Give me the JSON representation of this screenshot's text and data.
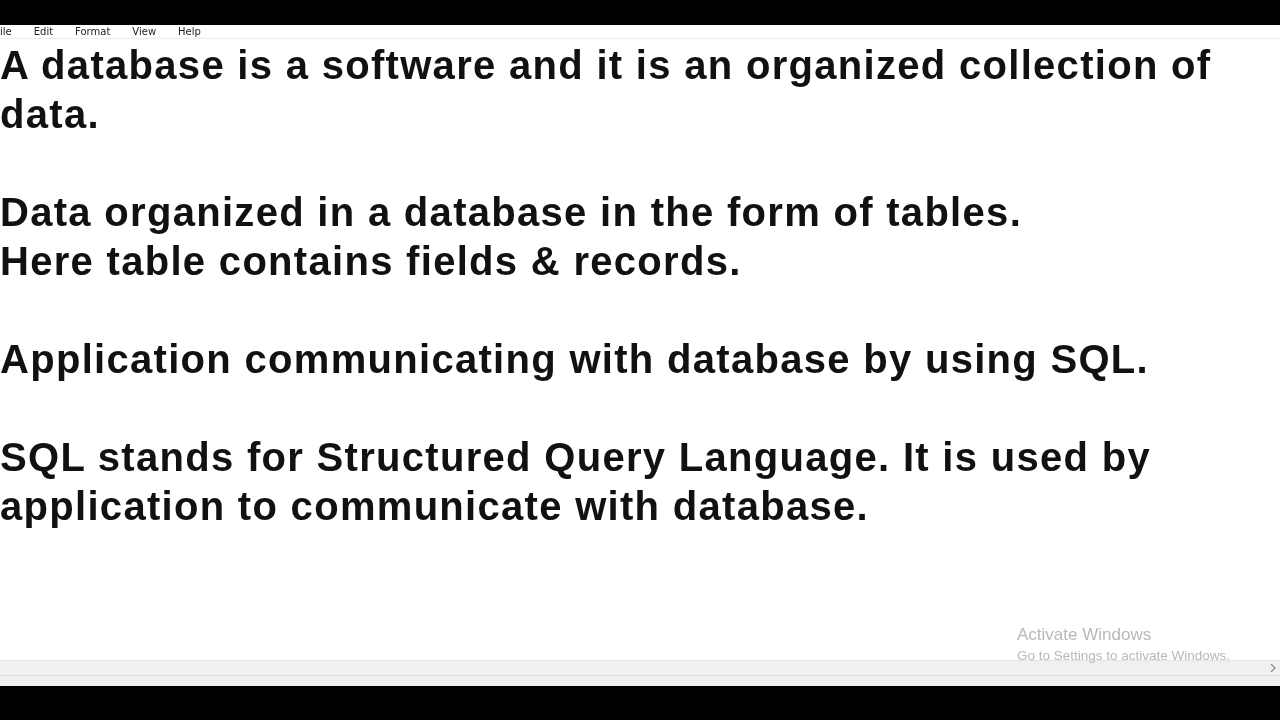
{
  "menu": [
    "ile",
    "Edit",
    "Format",
    "View",
    "Help"
  ],
  "paragraphs": [
    [
      "A database is a software and it is an organized collection of",
      "data."
    ],
    [
      "Data organized in a database in the form of tables.",
      "Here table contains fields & records."
    ],
    [
      "Application communicating with database by using SQL."
    ],
    [
      "SQL stands for Structured Query Language. It is used by",
      "application to communicate with database."
    ]
  ],
  "activation": {
    "title": "Activate Windows",
    "message": "Go to Settings to activate Windows."
  }
}
